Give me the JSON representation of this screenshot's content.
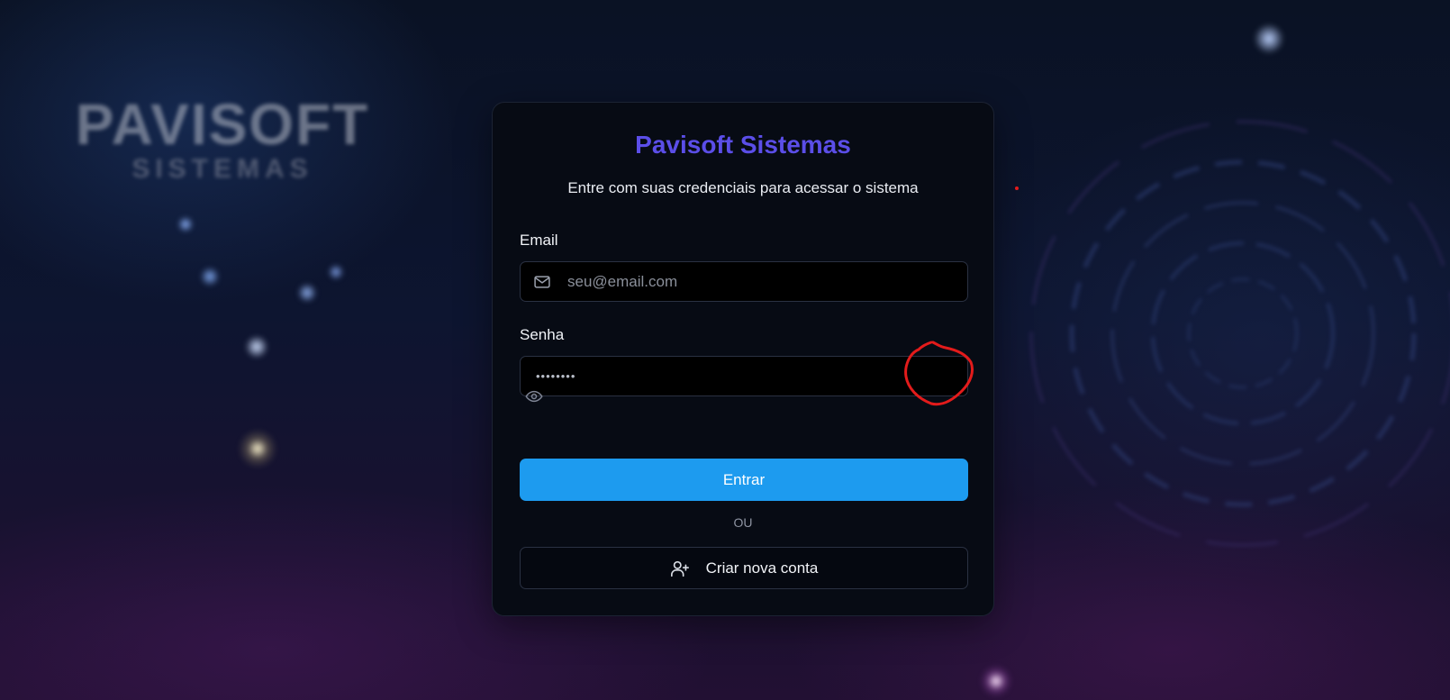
{
  "background": {
    "logo_main": "PAVISOFT",
    "logo_sub": "SISTEMAS"
  },
  "login": {
    "title": "Pavisoft Sistemas",
    "subtitle": "Entre com suas credenciais para acessar o sistema",
    "email": {
      "label": "Email",
      "placeholder": "seu@email.com",
      "value": "",
      "icon": "mail-icon"
    },
    "password": {
      "label": "Senha",
      "value": "••••••••",
      "toggle_icon": "eye-icon"
    },
    "submit_label": "Entrar",
    "divider_text": "OU",
    "create_account": {
      "label": "Criar nova conta",
      "icon": "user-plus-icon"
    }
  },
  "colors": {
    "title": "#5b4ee8",
    "primary_button": "#1d9bef",
    "card_background": "#070b14",
    "annotation": "#e31b1b"
  }
}
